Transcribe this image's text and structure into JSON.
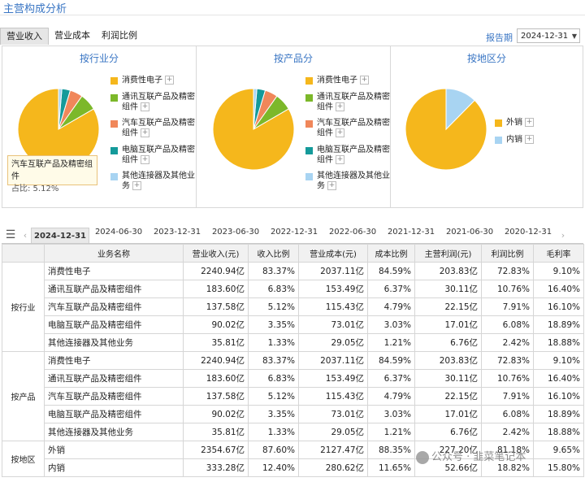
{
  "title": "主营构成分析",
  "tabs": [
    "营业收入",
    "营业成本",
    "利润比例"
  ],
  "report_label": "报告期",
  "report_date": "2024-12-31",
  "chart_data": [
    {
      "type": "pie",
      "title": "按行业分",
      "categories": [
        "消费性电子",
        "通讯互联产品及精密组件",
        "汽车互联产品及精密组件",
        "电脑互联产品及精密组件",
        "其他连接器及其他业务"
      ],
      "values": [
        83.37,
        6.83,
        5.12,
        3.35,
        1.33
      ],
      "colors": [
        "#f5b71c",
        "#7cb82a",
        "#f0875a",
        "#149a9a",
        "#a8d4f2"
      ]
    },
    {
      "type": "pie",
      "title": "按产品分",
      "categories": [
        "消费性电子",
        "通讯互联产品及精密组件",
        "汽车互联产品及精密组件",
        "电脑互联产品及精密组件",
        "其他连接器及其他业务"
      ],
      "values": [
        83.37,
        6.83,
        5.12,
        3.35,
        1.33
      ],
      "colors": [
        "#f5b71c",
        "#7cb82a",
        "#f0875a",
        "#149a9a",
        "#a8d4f2"
      ]
    },
    {
      "type": "pie",
      "title": "按地区分",
      "categories": [
        "外销",
        "内销"
      ],
      "values": [
        87.6,
        12.4
      ],
      "colors": [
        "#f5b71c",
        "#a8d4f2"
      ]
    }
  ],
  "tooltip": {
    "title": "汽车互联产品及精密组件",
    "value": "占比: 5.12%"
  },
  "periods": [
    "2024-12-31",
    "2024-06-30",
    "2023-12-31",
    "2023-06-30",
    "2022-12-31",
    "2022-06-30",
    "2021-12-31",
    "2021-06-30",
    "2020-12-31"
  ],
  "table": {
    "headers": [
      "业务名称",
      "营业收入(元)",
      "收入比例",
      "营业成本(元)",
      "成本比例",
      "主营利润(元)",
      "利润比例",
      "毛利率"
    ],
    "groups": [
      {
        "label": "按行业",
        "rows": [
          [
            "消费性电子",
            "2240.94亿",
            "83.37%",
            "2037.11亿",
            "84.59%",
            "203.83亿",
            "72.83%",
            "9.10%"
          ],
          [
            "通讯互联产品及精密组件",
            "183.60亿",
            "6.83%",
            "153.49亿",
            "6.37%",
            "30.11亿",
            "10.76%",
            "16.40%"
          ],
          [
            "汽车互联产品及精密组件",
            "137.58亿",
            "5.12%",
            "115.43亿",
            "4.79%",
            "22.15亿",
            "7.91%",
            "16.10%"
          ],
          [
            "电脑互联产品及精密组件",
            "90.02亿",
            "3.35%",
            "73.01亿",
            "3.03%",
            "17.01亿",
            "6.08%",
            "18.89%"
          ],
          [
            "其他连接器及其他业务",
            "35.81亿",
            "1.33%",
            "29.05亿",
            "1.21%",
            "6.76亿",
            "2.42%",
            "18.88%"
          ]
        ]
      },
      {
        "label": "按产品",
        "rows": [
          [
            "消费性电子",
            "2240.94亿",
            "83.37%",
            "2037.11亿",
            "84.59%",
            "203.83亿",
            "72.83%",
            "9.10%"
          ],
          [
            "通讯互联产品及精密组件",
            "183.60亿",
            "6.83%",
            "153.49亿",
            "6.37%",
            "30.11亿",
            "10.76%",
            "16.40%"
          ],
          [
            "汽车互联产品及精密组件",
            "137.58亿",
            "5.12%",
            "115.43亿",
            "4.79%",
            "22.15亿",
            "7.91%",
            "16.10%"
          ],
          [
            "电脑互联产品及精密组件",
            "90.02亿",
            "3.35%",
            "73.01亿",
            "3.03%",
            "17.01亿",
            "6.08%",
            "18.89%"
          ],
          [
            "其他连接器及其他业务",
            "35.81亿",
            "1.33%",
            "29.05亿",
            "1.21%",
            "6.76亿",
            "2.42%",
            "18.88%"
          ]
        ]
      },
      {
        "label": "按地区",
        "rows": [
          [
            "外销",
            "2354.67亿",
            "87.60%",
            "2127.47亿",
            "88.35%",
            "227.20亿",
            "81.18%",
            "9.65%"
          ],
          [
            "内销",
            "333.28亿",
            "12.40%",
            "280.62亿",
            "11.65%",
            "52.66亿",
            "18.82%",
            "15.80%"
          ]
        ]
      }
    ]
  },
  "watermark": "公众号 · 韭菜笔记本"
}
